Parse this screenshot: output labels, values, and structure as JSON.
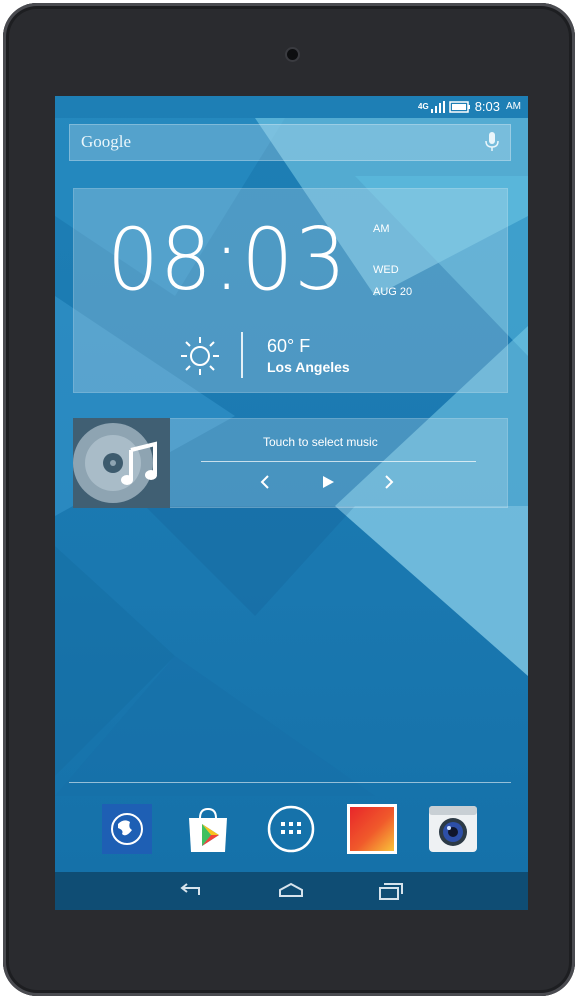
{
  "status_bar": {
    "network": "4G",
    "time": "8:03",
    "ampm": "AM"
  },
  "search": {
    "brand": "Google",
    "mic_icon": "microphone-icon"
  },
  "clock_widget": {
    "time": "08:03",
    "ampm": "AM",
    "day": "WED",
    "date": "AUG 20",
    "weather_icon": "sun-icon",
    "temperature": "60° F",
    "location": "Los Angeles"
  },
  "music_widget": {
    "album_icon": "music-note-icon",
    "prompt": "Touch to select music",
    "prev_icon": "previous-icon",
    "play_icon": "play-icon",
    "next_icon": "next-icon"
  },
  "dock": {
    "apps": [
      {
        "icon": "browser-globe-icon"
      },
      {
        "icon": "play-store-icon"
      },
      {
        "icon": "app-drawer-icon"
      },
      {
        "icon": "gallery-icon"
      },
      {
        "icon": "camera-icon"
      }
    ]
  },
  "navigation": {
    "back": "back-icon",
    "home": "home-icon",
    "recents": "recents-icon"
  },
  "colors": {
    "wallpaper": "#1a78b0",
    "navbar": "#0f4d74",
    "bezel": "#2a2b2f"
  }
}
